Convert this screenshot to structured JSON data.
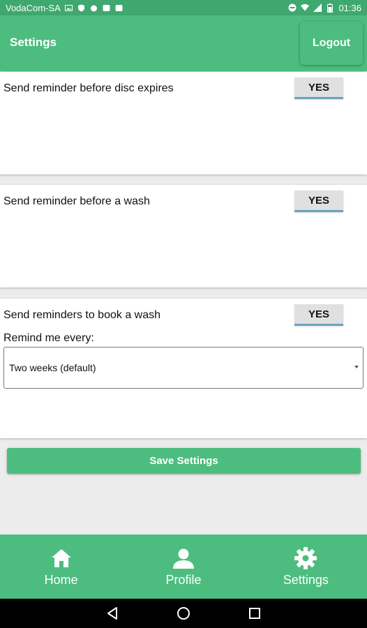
{
  "status_bar": {
    "carrier": "VodaCom-SA",
    "time": "01:36"
  },
  "header": {
    "title": "Settings",
    "logout_label": "Logout"
  },
  "settings": {
    "disc_reminder": {
      "label": "Send reminder before disc expires",
      "value": "YES"
    },
    "wash_reminder": {
      "label": "Send reminder before a wash",
      "value": "YES"
    },
    "book_reminder": {
      "label": "Send reminders to book a wash",
      "value": "YES",
      "remind_label": "Remind me every:",
      "frequency": "Two weeks (default)"
    }
  },
  "save_label": "Save Settings",
  "bottom_nav": {
    "items": [
      {
        "label": "Home",
        "icon": "home-icon"
      },
      {
        "label": "Profile",
        "icon": "person-icon"
      },
      {
        "label": "Settings",
        "icon": "gear-icon"
      }
    ]
  },
  "colors": {
    "primary": "#4dbd7f",
    "status_bar": "#3fa86f",
    "toggle_bg": "#e0e0e0",
    "toggle_accent": "#6aa2c0"
  }
}
